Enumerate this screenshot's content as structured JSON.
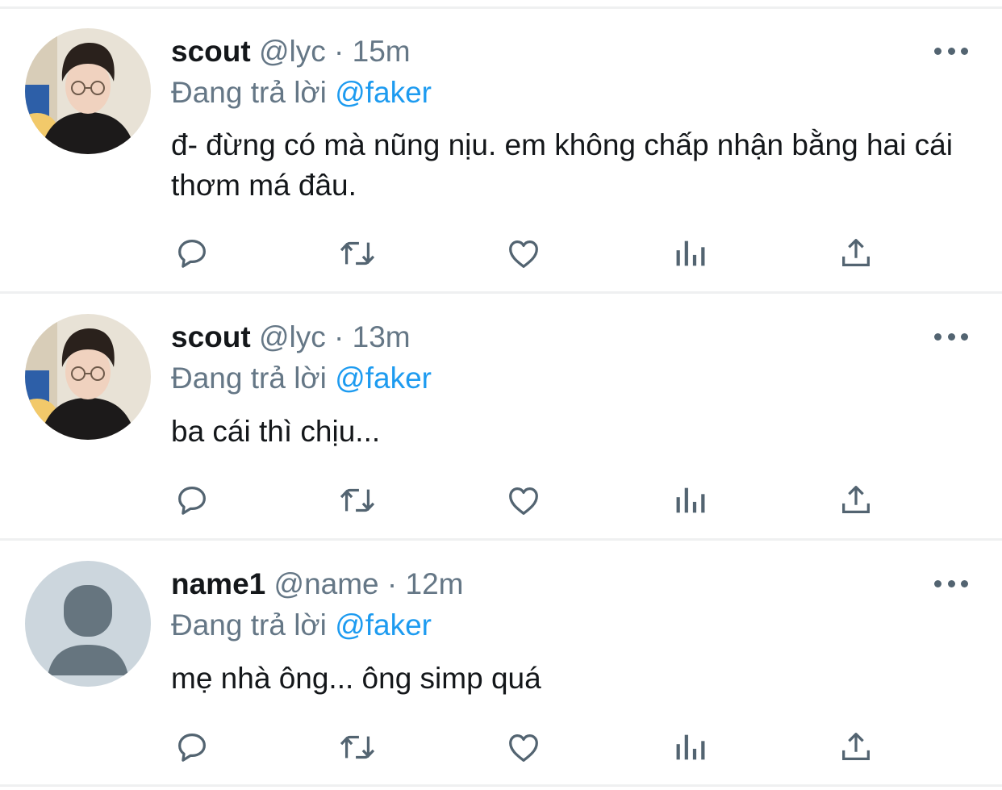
{
  "reply_prefix": "Đang trả lời",
  "tweets": [
    {
      "name": "scout",
      "handle": "@lyc",
      "separator": "·",
      "time": "15m",
      "reply_to": "@faker",
      "text": "đ- đừng có mà nũng nịu. em không chấp nhận bằng hai cái thơm má đâu.",
      "avatar": "photo"
    },
    {
      "name": "scout",
      "handle": "@lyc",
      "separator": "·",
      "time": "13m",
      "reply_to": "@faker",
      "text": "ba cái thì chịu...",
      "avatar": "photo"
    },
    {
      "name": "name1",
      "handle": "@name",
      "separator": "·",
      "time": "12m",
      "reply_to": "@faker",
      "text": "mẹ nhà ông... ông simp quá",
      "avatar": "default"
    }
  ],
  "actions": [
    "reply-icon",
    "retweet-icon",
    "like-icon",
    "views-icon",
    "share-icon"
  ],
  "colors": {
    "mention": "#1d9bf0",
    "secondary_text": "#657786",
    "primary_text": "#14171a",
    "icon": "#536471",
    "divider": "#eff0f1"
  }
}
